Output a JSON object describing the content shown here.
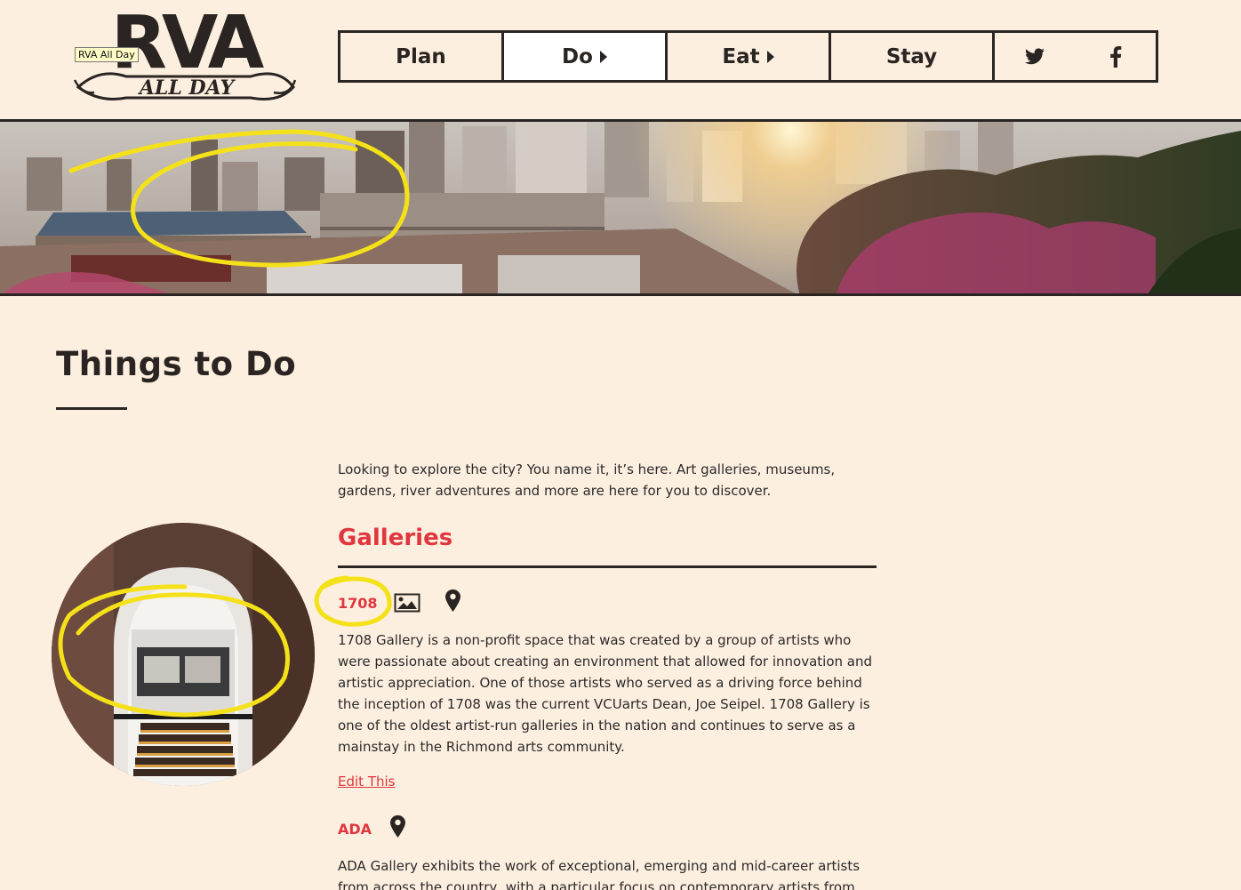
{
  "logo": {
    "letters": "RVA",
    "script": "ALL DAY",
    "tooltip": "RVA All Day"
  },
  "nav": {
    "items": [
      {
        "label": "Plan",
        "has_caret": false
      },
      {
        "label": "Do",
        "has_caret": true
      },
      {
        "label": "Eat",
        "has_caret": true
      },
      {
        "label": "Stay",
        "has_caret": false
      }
    ],
    "social": [
      "twitter-icon",
      "facebook-icon"
    ]
  },
  "page": {
    "title": "Things to Do",
    "intro": "Looking to explore the city? You name it, it’s here. Art galleries, museums, gardens, river adventures and more are here for you to discover."
  },
  "sections": [
    {
      "heading": "Galleries",
      "listings": [
        {
          "title": "1708",
          "icons": [
            "image-icon",
            "map-pin-icon"
          ],
          "description": "1708 Gallery is a non-profit space that was created by a group of artists who were passionate about creating an environment that allowed for innovation and artistic appreciation. One of those artists who served as a driving force behind the inception of 1708 was the current VCUarts Dean, Joe Seipel. 1708 Gallery is one of the oldest artist-run galleries in the nation and continues to serve as a mainstay in the Richmond arts community.",
          "edit_label": "Edit This"
        },
        {
          "title": "ADA",
          "icons": [
            "map-pin-icon"
          ],
          "description": "ADA Gallery exhibits the work of exceptional, emerging and mid-career artists from across the country, with a particular focus on contemporary artists from the Mid-"
        }
      ]
    }
  ],
  "colors": {
    "background": "#fdefdf",
    "accent": "#e0363f",
    "dark": "#2a2522",
    "annotation": "#f5e11a"
  }
}
